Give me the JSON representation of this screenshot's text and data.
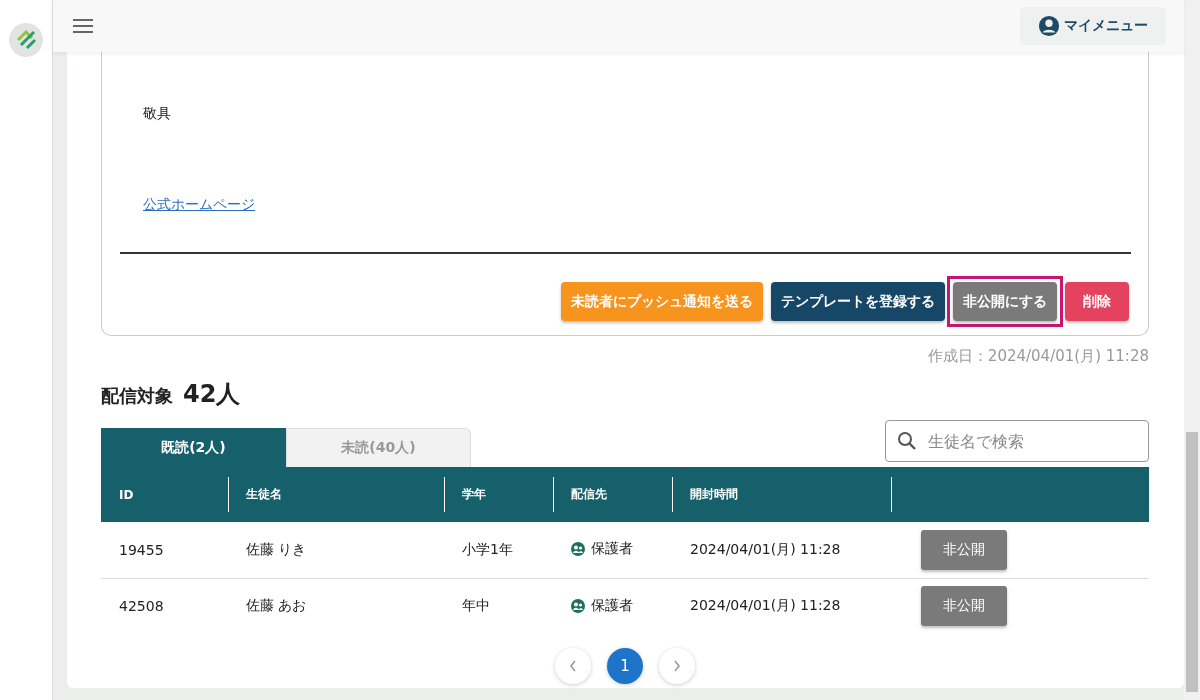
{
  "header": {
    "my_menu": "マイメニュー"
  },
  "letter": {
    "closing": "敬具",
    "link": "公式ホームページ",
    "actions": [
      {
        "kind": "push",
        "label": "未読者にプッシュ通知を送る",
        "highlighted": false
      },
      {
        "kind": "template",
        "label": "テンプレートを登録する",
        "highlighted": false
      },
      {
        "kind": "unpublish",
        "label": "非公開にする",
        "highlighted": true
      },
      {
        "kind": "delete",
        "label": "削除",
        "highlighted": false
      }
    ]
  },
  "created": "作成日：2024/04/01(月) 11:28",
  "recipients": {
    "title": "配信対象",
    "count": "42人"
  },
  "tabs": [
    {
      "label": "既読(2人)",
      "selected": true
    },
    {
      "label": "未読(40人)",
      "selected": false
    }
  ],
  "search": {
    "placeholder": "生徒名で検索"
  },
  "table": {
    "columns": [
      "ID",
      "生徒名",
      "学年",
      "配信先",
      "開封時間"
    ],
    "rows": [
      {
        "id": "19455",
        "name": "佐藤 りき",
        "grade": "小学1年",
        "target": "保護者",
        "opened": "2024/04/01(月) 11:28",
        "action": "非公開"
      },
      {
        "id": "42508",
        "name": "佐藤 あお",
        "grade": "年中",
        "target": "保護者",
        "opened": "2024/04/01(月) 11:28",
        "action": "非公開"
      }
    ]
  },
  "pagination": {
    "pages": [
      {
        "label": "1",
        "selected": true
      }
    ]
  }
}
